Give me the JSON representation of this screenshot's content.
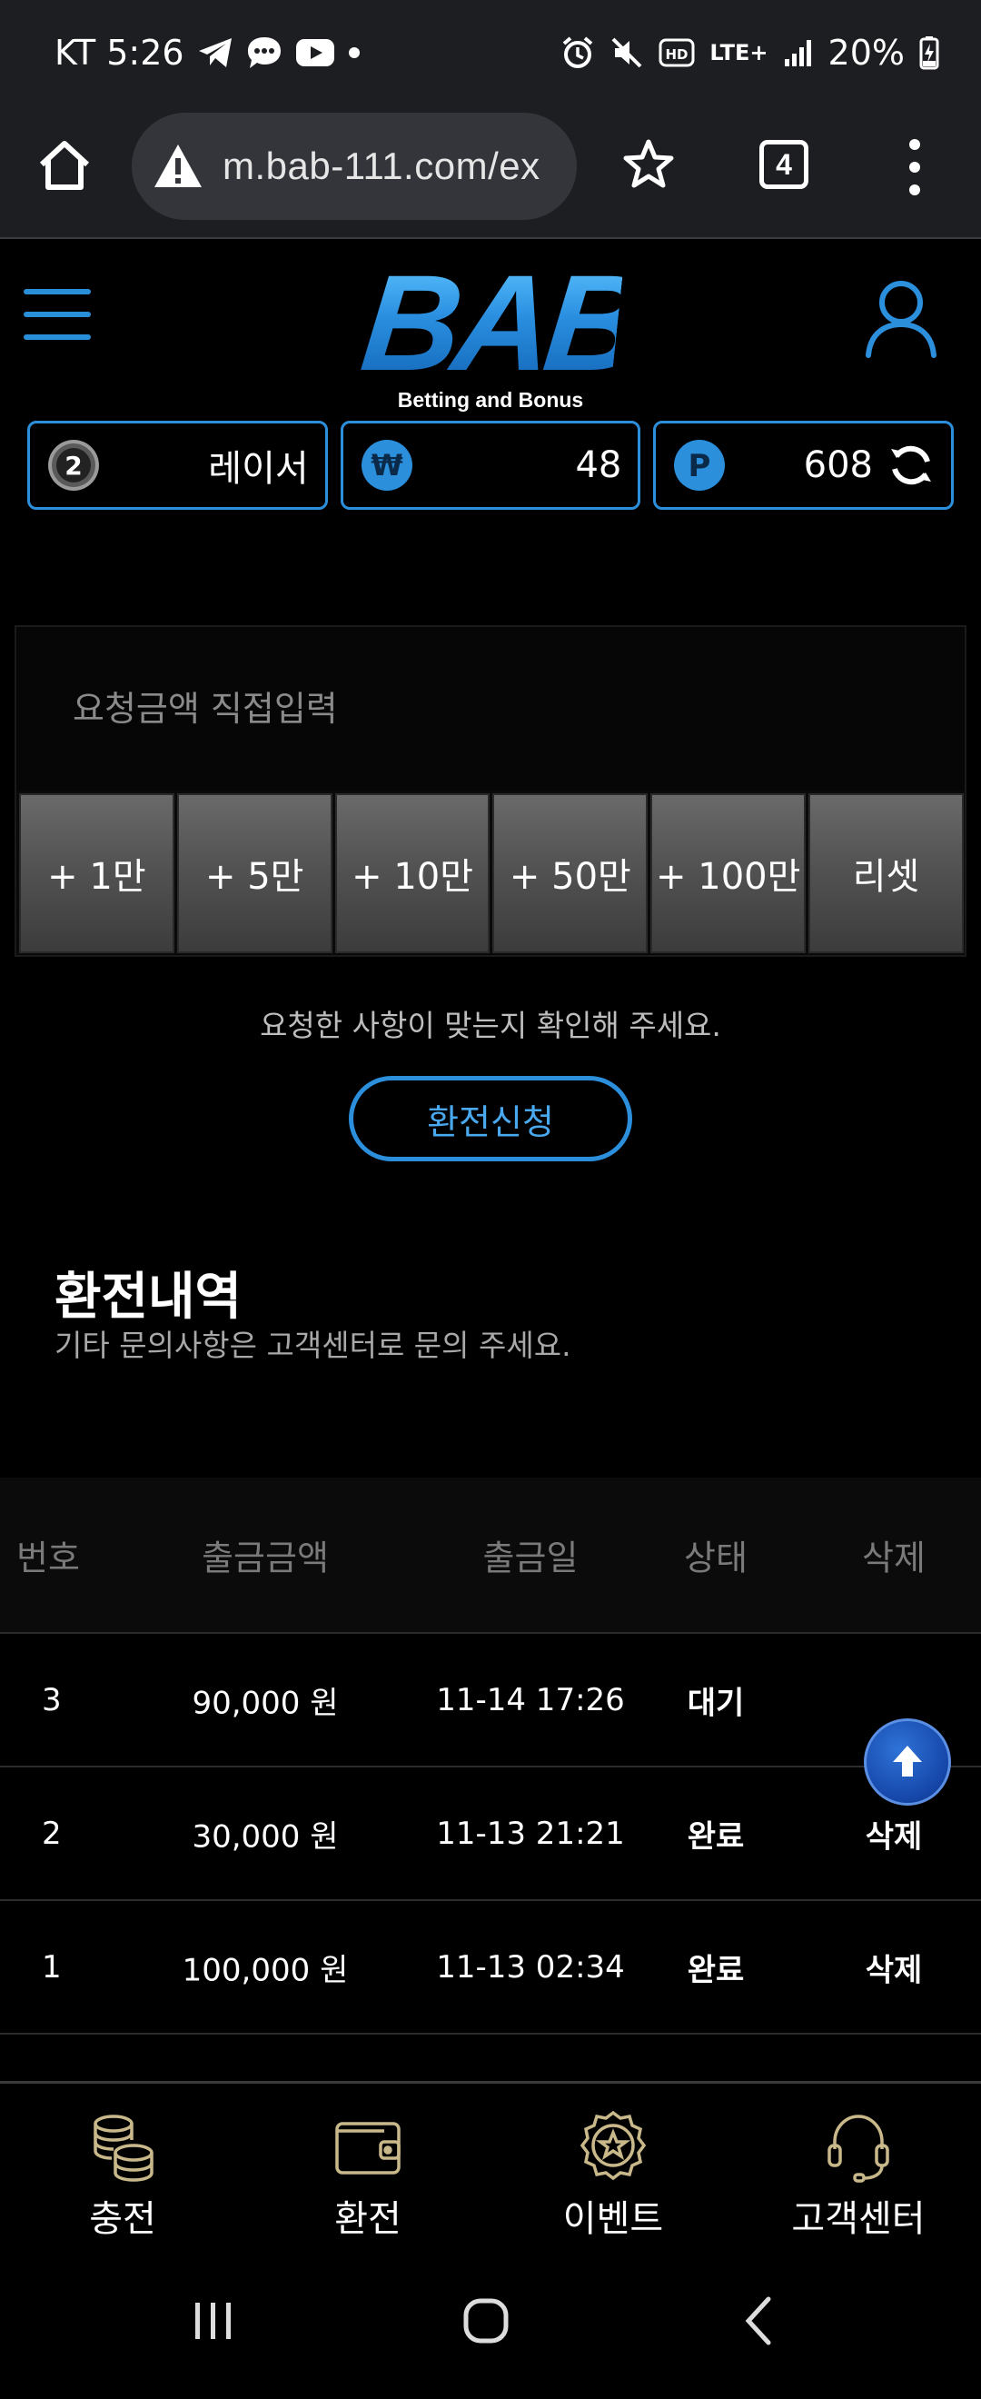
{
  "status_bar": {
    "carrier_time": "KT 5:26",
    "network": "LTE+",
    "battery": "20%"
  },
  "browser": {
    "url": "m.bab-111.com/ex",
    "tab_count": "4"
  },
  "header": {
    "logo_text": "BAB",
    "logo_subtitle": "Betting and Bonus"
  },
  "account": {
    "level_badge": "2",
    "level_name": "레이서",
    "money_symbol": "₩",
    "money": "48",
    "point_symbol": "P",
    "points": "608"
  },
  "exchange_form": {
    "amount_placeholder": "요청금액 직접입력",
    "quick_buttons": [
      "+ 1만",
      "+ 5만",
      "+ 10만",
      "+ 50만",
      "+ 100만",
      "리셋"
    ],
    "confirm_text": "요청한 사항이 맞는지 확인해 주세요.",
    "apply_label": "환전신청"
  },
  "history": {
    "title": "환전내역",
    "subtitle": "기타 문의사항은 고객센터로 문의 주세요.",
    "columns": [
      "번호",
      "출금금액",
      "출금일",
      "상태",
      "삭제"
    ],
    "rows": [
      {
        "no": "3",
        "amount": "90,000 원",
        "date": "11-14 17:26",
        "status": "대기",
        "delete": ""
      },
      {
        "no": "2",
        "amount": "30,000 원",
        "date": "11-13 21:21",
        "status": "완료",
        "delete": "삭제"
      },
      {
        "no": "1",
        "amount": "100,000 원",
        "date": "11-13 02:34",
        "status": "완료",
        "delete": "삭제"
      }
    ]
  },
  "bottom_nav": [
    {
      "label": "충전",
      "icon": "coins-icon"
    },
    {
      "label": "환전",
      "icon": "wallet-icon"
    },
    {
      "label": "이벤트",
      "icon": "star-badge-icon"
    },
    {
      "label": "고객센터",
      "icon": "headset-icon"
    }
  ],
  "colors": {
    "accent": "#2b8fdc",
    "background": "#000000",
    "button_gray": "#555555"
  }
}
